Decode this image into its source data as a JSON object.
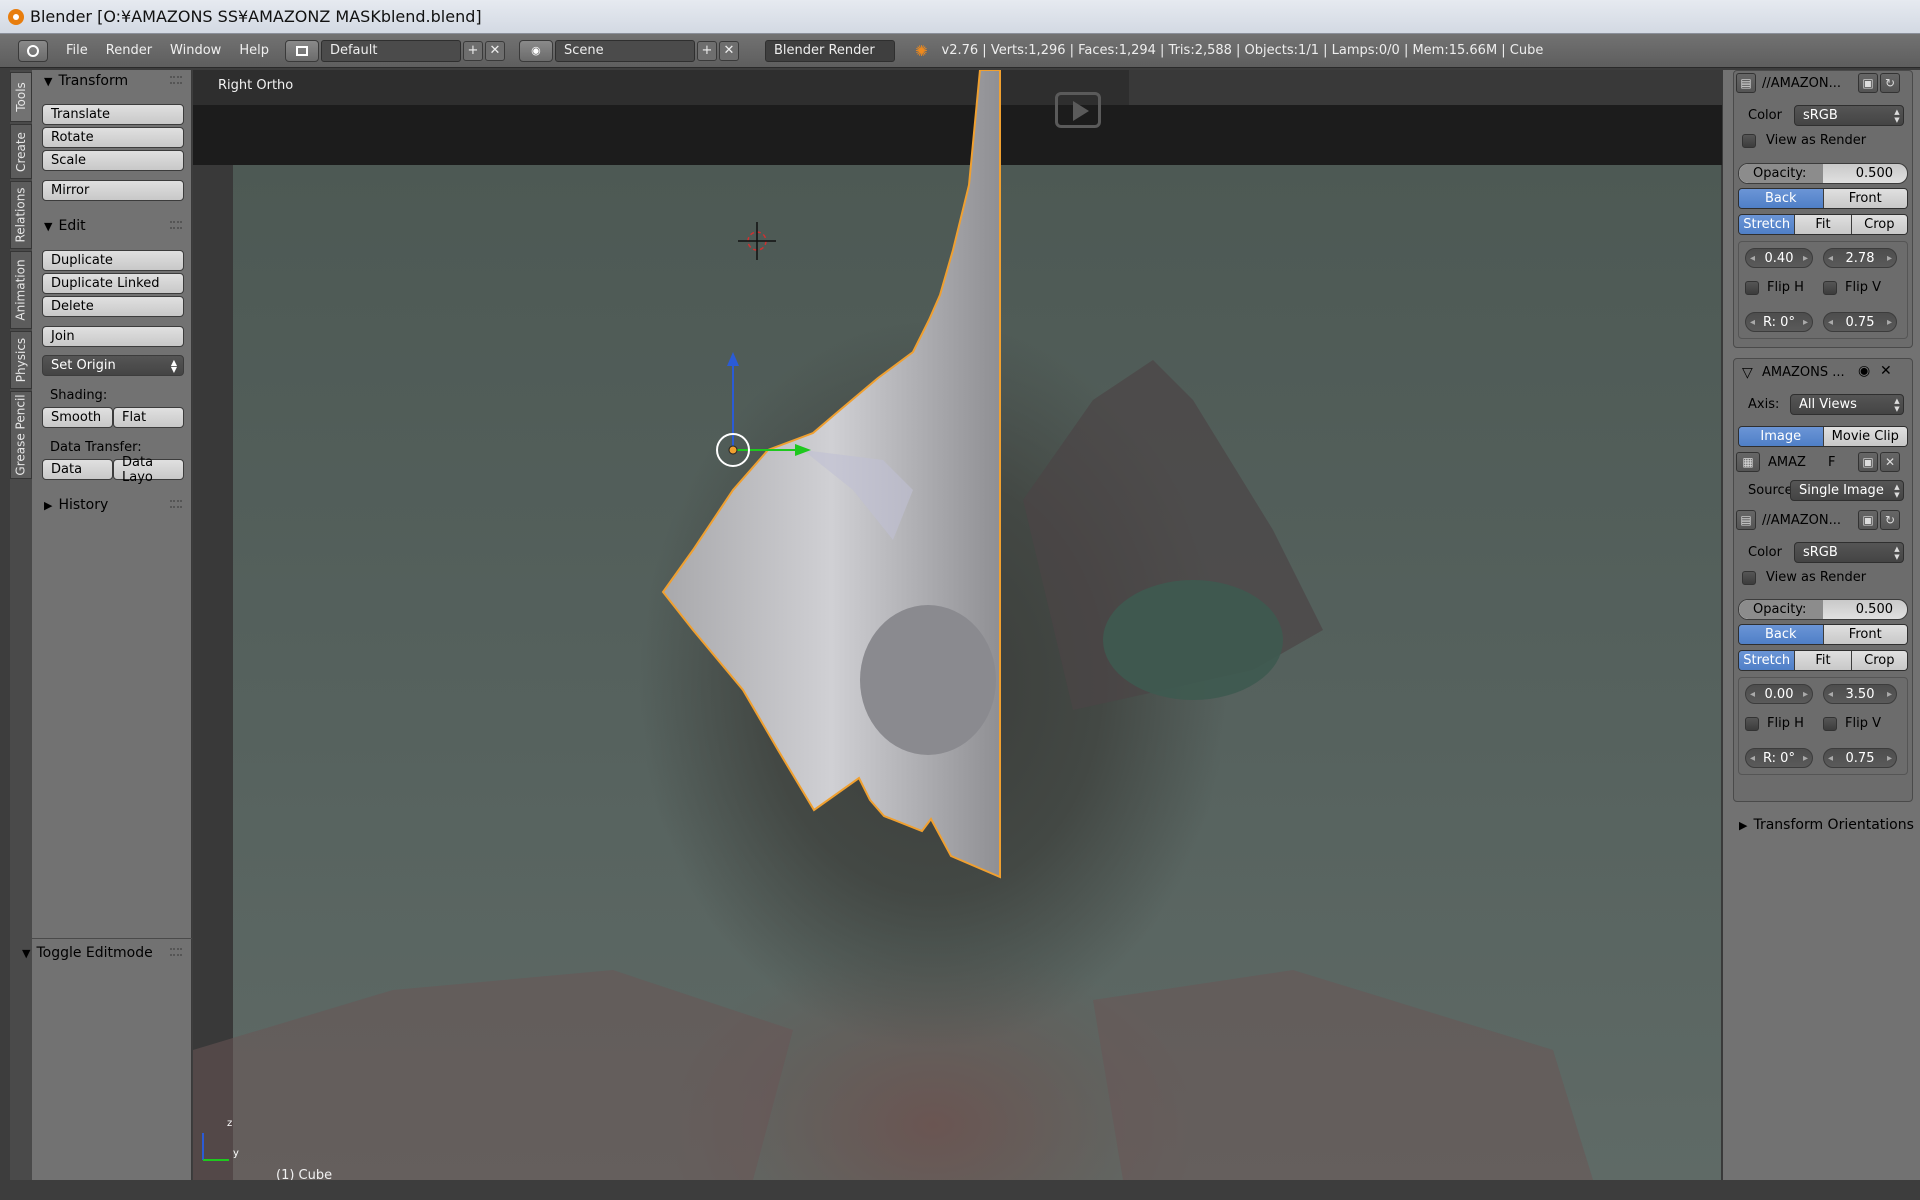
{
  "window": {
    "title": "Blender [O:¥AMAZONS SS¥AMAZONZ MASKblend.blend]"
  },
  "header": {
    "menus": [
      "File",
      "Render",
      "Window",
      "Help"
    ],
    "layout": "Default",
    "scene": "Scene",
    "engine": "Blender Render",
    "stats": "v2.76 | Verts:1,296 | Faces:1,294 | Tris:2,588 | Objects:1/1 | Lamps:0/0 | Mem:15.66M | Cube"
  },
  "tool_tabs": [
    "Tools",
    "Create",
    "Relations",
    "Animation",
    "Physics",
    "Grease Pencil"
  ],
  "toolshelf": {
    "transform": {
      "title": "Transform",
      "buttons": [
        "Translate",
        "Rotate",
        "Scale",
        "Mirror"
      ]
    },
    "edit": {
      "title": "Edit",
      "buttons": [
        "Duplicate",
        "Duplicate Linked",
        "Delete",
        "Join"
      ],
      "set_origin": "Set Origin",
      "shading_label": "Shading:",
      "shading": [
        "Smooth",
        "Flat"
      ],
      "data_transfer_label": "Data Transfer:",
      "data_transfer": [
        "Data",
        "Data Layo"
      ]
    },
    "history": "History",
    "toggle_editmode": "Toggle Editmode"
  },
  "viewport": {
    "view_label": "Right Ortho",
    "object_label": "(1) Cube",
    "axis_z": "z",
    "axis_y": "y"
  },
  "properties": {
    "top": {
      "path": "//AMAZON...",
      "color_label": "Color",
      "color_value": "sRGB",
      "view_as_render": "View as Render",
      "opacity_label": "Opacity:",
      "opacity_value": "0.500",
      "side": [
        "Back",
        "Front"
      ],
      "side_active": "Back",
      "fit": [
        "Stretch",
        "Fit",
        "Crop"
      ],
      "fit_active": "Stretch",
      "offset_x": "0.40",
      "offset_y": "2.78",
      "flip_h": "Flip H",
      "flip_v": "Flip V",
      "rotation": "R: 0°",
      "size": "0.75"
    },
    "second": {
      "title": "AMAZONS ...",
      "axis_label": "Axis:",
      "axis_value": "All Views",
      "type": [
        "Image",
        "Movie Clip"
      ],
      "type_active": "Image",
      "image_name": "AMAZ",
      "image_f": "F",
      "source_label": "Source",
      "source_value": "Single Image",
      "path": "//AMAZON...",
      "color_label": "Color",
      "color_value": "sRGB",
      "view_as_render": "View as Render",
      "opacity_label": "Opacity:",
      "opacity_value": "0.500",
      "side": [
        "Back",
        "Front"
      ],
      "side_active": "Back",
      "fit": [
        "Stretch",
        "Fit",
        "Crop"
      ],
      "fit_active": "Stretch",
      "offset_x": "0.00",
      "offset_y": "3.50",
      "flip_h": "Flip H",
      "flip_v": "Flip V",
      "rotation": "R: 0°",
      "size": "0.75"
    },
    "transform_orientations": "Transform Orientations"
  },
  "colors": {
    "accent_blue": "#5680c2",
    "selection_orange": "#f0a030",
    "panel_grey": "#727272"
  }
}
